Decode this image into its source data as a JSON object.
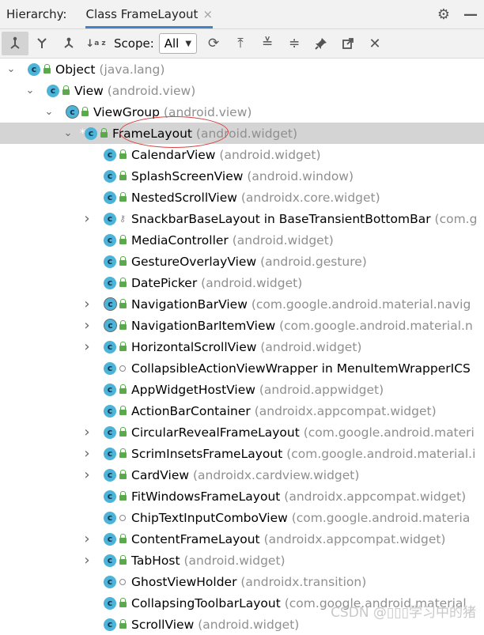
{
  "header": {
    "label": "Hierarchy:",
    "tab_title": "Class FrameLayout",
    "close_glyph": "×"
  },
  "toolbar": {
    "scope_label": "Scope:",
    "scope_value": "All"
  },
  "tree": [
    {
      "level": 0,
      "expand": "open",
      "name": "Object",
      "pkg": "(java.lang)",
      "icon": "class",
      "vis": "lock"
    },
    {
      "level": 1,
      "expand": "open",
      "name": "View",
      "pkg": "(android.view)",
      "icon": "class",
      "vis": "lock"
    },
    {
      "level": 2,
      "expand": "open",
      "name": "ViewGroup",
      "pkg": "(android.view)",
      "icon": "abstract",
      "vis": "lock"
    },
    {
      "level": 3,
      "expand": "open",
      "name": "FrameLayout",
      "pkg": "(android.widget)",
      "icon": "class",
      "vis": "lock",
      "selected": true,
      "star": true
    },
    {
      "level": 4,
      "expand": "none",
      "name": "CalendarView",
      "pkg": "(android.widget)",
      "icon": "class",
      "vis": "lock"
    },
    {
      "level": 4,
      "expand": "none",
      "name": "SplashScreenView",
      "pkg": "(android.window)",
      "icon": "class",
      "vis": "lock"
    },
    {
      "level": 4,
      "expand": "none",
      "name": "NestedScrollView",
      "pkg": "(androidx.core.widget)",
      "icon": "class",
      "vis": "lock"
    },
    {
      "level": 4,
      "expand": "closed",
      "name": "SnackbarBaseLayout in BaseTransientBottomBar",
      "pkg": "(com.g",
      "icon": "class",
      "vis": "key"
    },
    {
      "level": 4,
      "expand": "none",
      "name": "MediaController",
      "pkg": "(android.widget)",
      "icon": "class",
      "vis": "lock"
    },
    {
      "level": 4,
      "expand": "none",
      "name": "GestureOverlayView",
      "pkg": "(android.gesture)",
      "icon": "class",
      "vis": "lock"
    },
    {
      "level": 4,
      "expand": "none",
      "name": "DatePicker",
      "pkg": "(android.widget)",
      "icon": "class",
      "vis": "lock"
    },
    {
      "level": 4,
      "expand": "closed",
      "name": "NavigationBarView",
      "pkg": "(com.google.android.material.navig",
      "icon": "abstract",
      "vis": "lock"
    },
    {
      "level": 4,
      "expand": "closed",
      "name": "NavigationBarItemView",
      "pkg": "(com.google.android.material.n",
      "icon": "abstract",
      "vis": "lock"
    },
    {
      "level": 4,
      "expand": "closed",
      "name": "HorizontalScrollView",
      "pkg": "(android.widget)",
      "icon": "class",
      "vis": "lock"
    },
    {
      "level": 4,
      "expand": "none",
      "name": "CollapsibleActionViewWrapper in MenuItemWrapperICS",
      "pkg": "",
      "icon": "class",
      "vis": "dot"
    },
    {
      "level": 4,
      "expand": "none",
      "name": "AppWidgetHostView",
      "pkg": "(android.appwidget)",
      "icon": "class",
      "vis": "lock"
    },
    {
      "level": 4,
      "expand": "none",
      "name": "ActionBarContainer",
      "pkg": "(androidx.appcompat.widget)",
      "icon": "class",
      "vis": "lock"
    },
    {
      "level": 4,
      "expand": "closed",
      "name": "CircularRevealFrameLayout",
      "pkg": "(com.google.android.materi",
      "icon": "class",
      "vis": "lock"
    },
    {
      "level": 4,
      "expand": "closed",
      "name": "ScrimInsetsFrameLayout",
      "pkg": "(com.google.android.material.i",
      "icon": "class",
      "vis": "lock"
    },
    {
      "level": 4,
      "expand": "closed",
      "name": "CardView",
      "pkg": "(androidx.cardview.widget)",
      "icon": "class",
      "vis": "lock"
    },
    {
      "level": 4,
      "expand": "none",
      "name": "FitWindowsFrameLayout",
      "pkg": "(androidx.appcompat.widget)",
      "icon": "class",
      "vis": "lock"
    },
    {
      "level": 4,
      "expand": "none",
      "name": "ChipTextInputComboView",
      "pkg": "(com.google.android.materia",
      "icon": "class",
      "vis": "dot"
    },
    {
      "level": 4,
      "expand": "closed",
      "name": "ContentFrameLayout",
      "pkg": "(androidx.appcompat.widget)",
      "icon": "class",
      "vis": "lock"
    },
    {
      "level": 4,
      "expand": "closed",
      "name": "TabHost",
      "pkg": "(android.widget)",
      "icon": "class",
      "vis": "lock"
    },
    {
      "level": 4,
      "expand": "none",
      "name": "GhostViewHolder",
      "pkg": "(androidx.transition)",
      "icon": "class",
      "vis": "dot"
    },
    {
      "level": 4,
      "expand": "none",
      "name": "CollapsingToolbarLayout",
      "pkg": "(com.google.android.material",
      "icon": "class",
      "vis": "lock"
    },
    {
      "level": 4,
      "expand": "none",
      "name": "ScrollView",
      "pkg": "(android.widget)",
      "icon": "class",
      "vis": "lock"
    }
  ],
  "watermark": "CSDN @▯▯▯学习中的猪",
  "colors": {
    "class_icon": "#4bb4d8",
    "visibility_public": "#5aaa4c",
    "package_text": "#8f8f8f",
    "selection": "#d4d4d4",
    "annotation_circle": "#d94141"
  }
}
